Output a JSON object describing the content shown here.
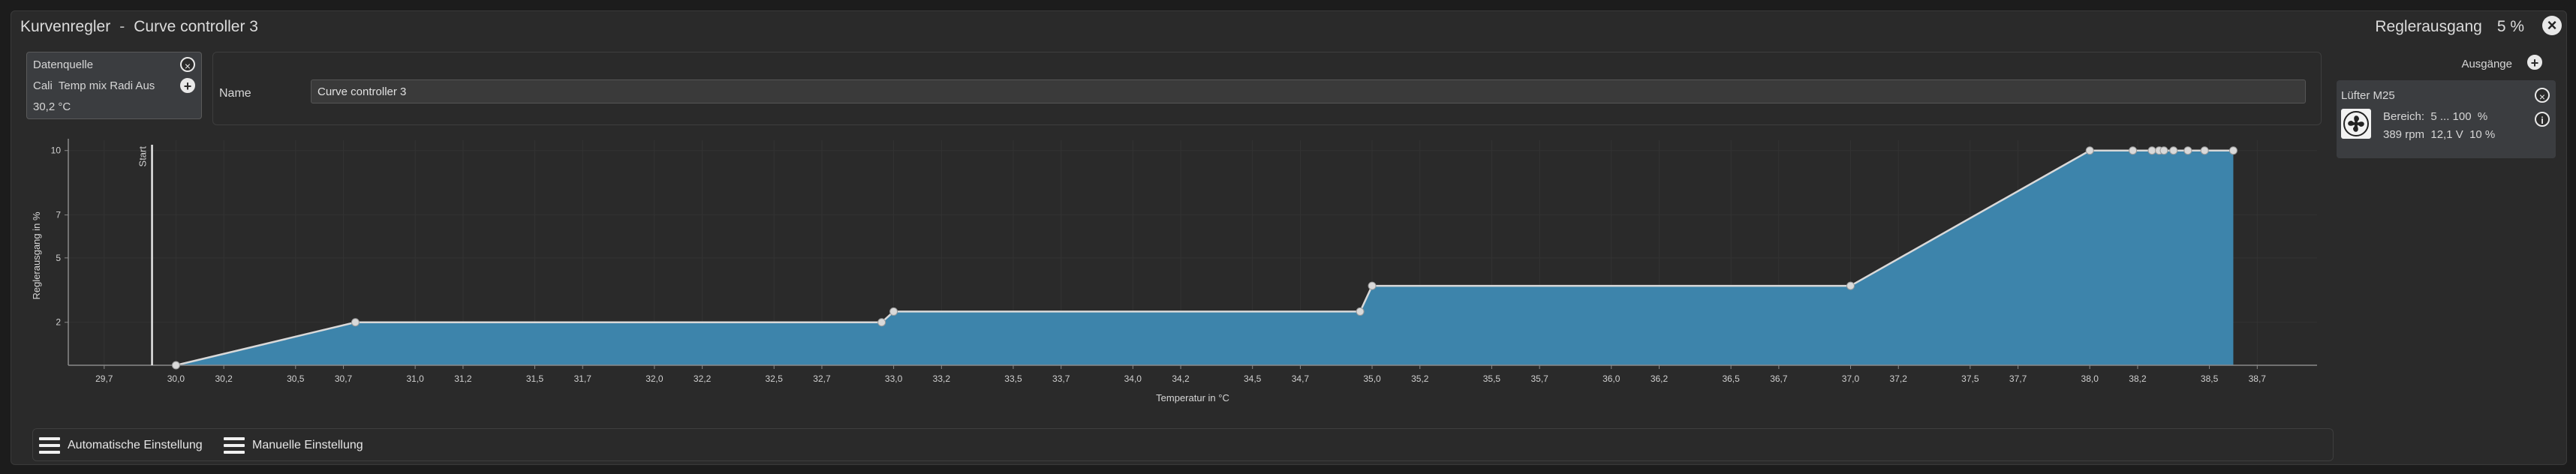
{
  "window": {
    "title_left": "Kurvenregler",
    "title_sep": "-",
    "title_right": "Curve controller 3",
    "output_label": "Reglerausgang",
    "output_value": "5 %"
  },
  "source": {
    "label": "Datenquelle",
    "name": "Cali  Temp mix Radi Aus",
    "value": "30,2 °C"
  },
  "name_field": {
    "label": "Name",
    "value": "Curve controller 3"
  },
  "outputs": {
    "label": "Ausgänge",
    "fan": {
      "name": "Lüfter M25",
      "range": "Bereich:  5 ... 100  %",
      "stats": "389 rpm  12,1 V  10 %"
    }
  },
  "bottom": {
    "auto_label": "Automatische Einstellung",
    "manual_label": "Manuelle Einstellung"
  },
  "colors": {
    "fill": "#3d84ab",
    "line": "#d9d9d9",
    "point": "#d9d9d9"
  },
  "chart_data": {
    "type": "area",
    "xlabel": "Temperatur in °C",
    "ylabel": "Reglerausgang in %",
    "start_label": "Start",
    "start_x": 29.9,
    "xlim": [
      29.55,
      38.95
    ],
    "ylim": [
      0,
      10.2
    ],
    "x_ticks": [
      "29,7",
      "30,0",
      "30,2",
      "30,5",
      "30,7",
      "31,0",
      "31,2",
      "31,5",
      "31,7",
      "32,0",
      "32,2",
      "32,5",
      "32,7",
      "33,0",
      "33,2",
      "33,5",
      "33,7",
      "34,0",
      "34,2",
      "34,5",
      "34,7",
      "35,0",
      "35,2",
      "35,5",
      "35,7",
      "36,0",
      "36,2",
      "36,5",
      "36,7",
      "37,0",
      "37,2",
      "37,5",
      "37,7",
      "38,0",
      "38,2",
      "38,5",
      "38,7"
    ],
    "y_ticks": [
      "2",
      "5",
      "7",
      "10"
    ],
    "curve": [
      {
        "x": 30.0,
        "y": 0
      },
      {
        "x": 30.75,
        "y": 2
      },
      {
        "x": 32.95,
        "y": 2
      },
      {
        "x": 33.0,
        "y": 2.5
      },
      {
        "x": 34.95,
        "y": 2.5
      },
      {
        "x": 35.0,
        "y": 3.7
      },
      {
        "x": 37.0,
        "y": 3.7
      },
      {
        "x": 38.0,
        "y": 10
      },
      {
        "x": 38.6,
        "y": 10
      }
    ],
    "points": [
      {
        "x": 30.0,
        "y": 0
      },
      {
        "x": 30.75,
        "y": 2
      },
      {
        "x": 32.95,
        "y": 2
      },
      {
        "x": 33.0,
        "y": 2.5
      },
      {
        "x": 34.95,
        "y": 2.5
      },
      {
        "x": 35.0,
        "y": 3.7
      },
      {
        "x": 37.0,
        "y": 3.7
      },
      {
        "x": 38.0,
        "y": 10
      },
      {
        "x": 38.18,
        "y": 10
      },
      {
        "x": 38.26,
        "y": 10
      },
      {
        "x": 38.29,
        "y": 10
      },
      {
        "x": 38.31,
        "y": 10
      },
      {
        "x": 38.35,
        "y": 10
      },
      {
        "x": 38.41,
        "y": 10
      },
      {
        "x": 38.48,
        "y": 10
      },
      {
        "x": 38.6,
        "y": 10
      }
    ]
  }
}
